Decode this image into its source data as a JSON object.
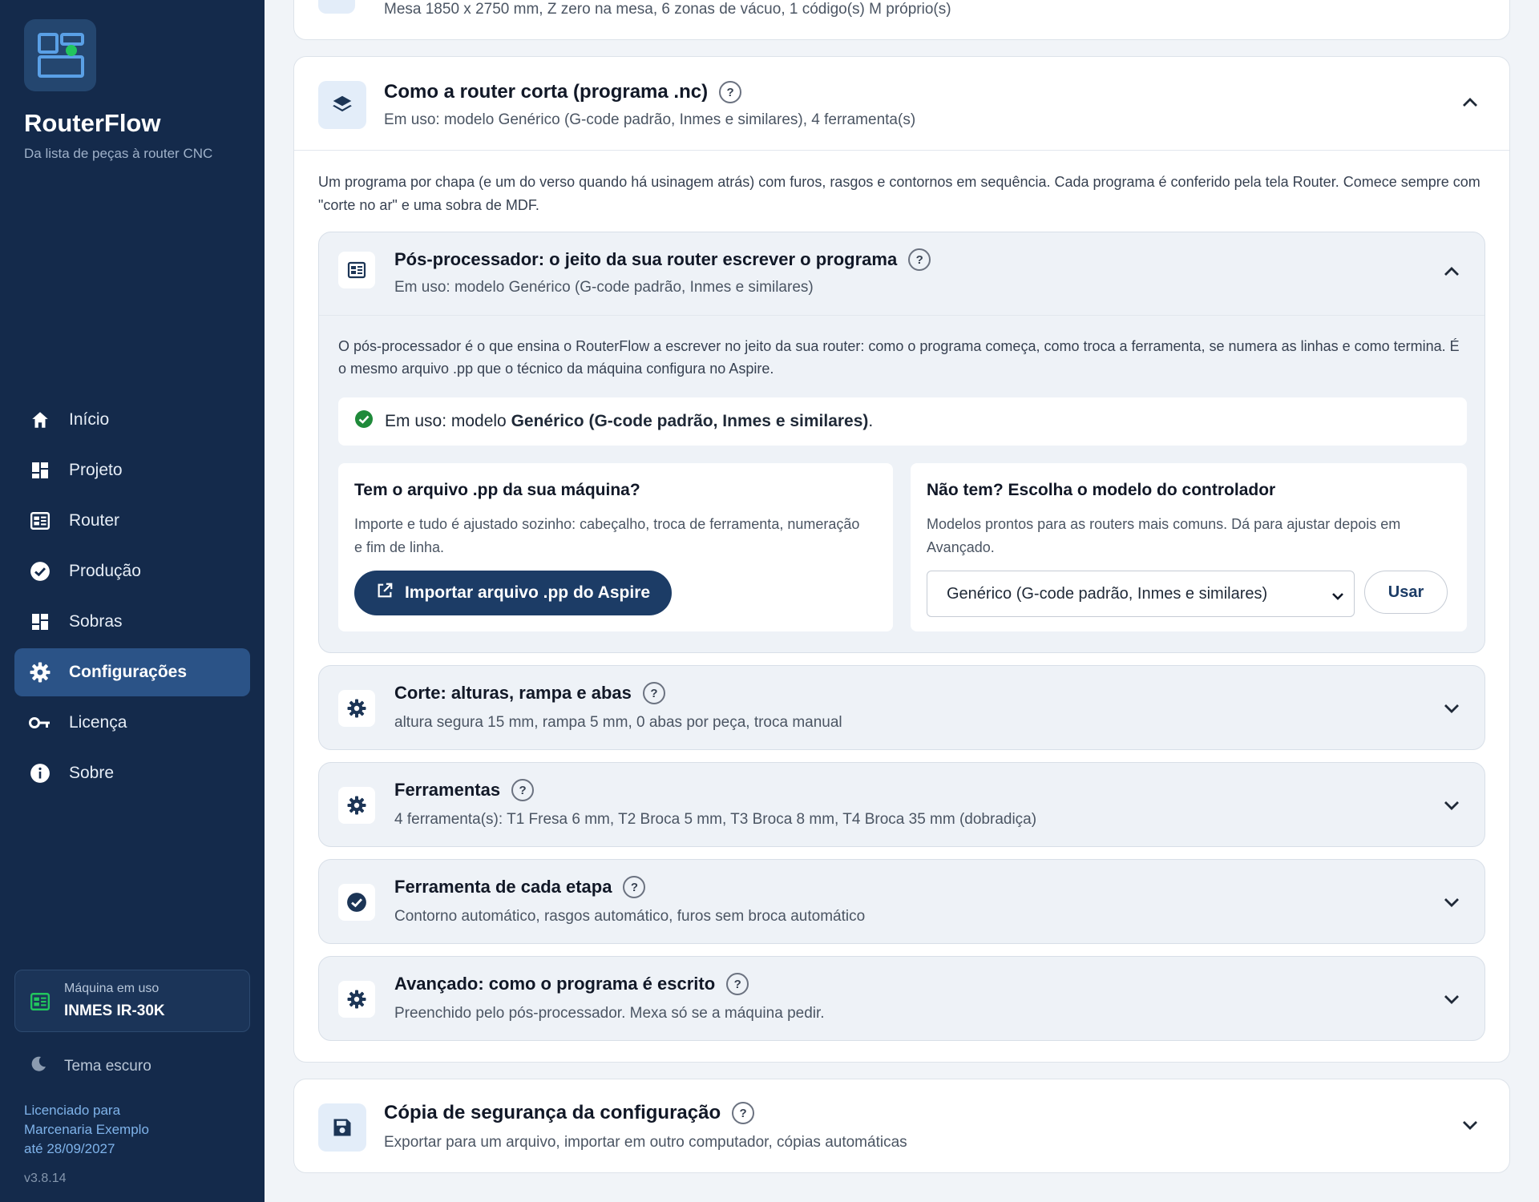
{
  "app": {
    "name": "RouterFlow",
    "tagline": "Da lista de peças à router CNC",
    "colors": {
      "sidebar_bg": "#142a4b",
      "accent": "#1c3c66",
      "success": "#1f8a3a",
      "logo_dot": "#22c55e"
    }
  },
  "sidebar": {
    "items": [
      {
        "label": "Início",
        "icon": "home-icon"
      },
      {
        "label": "Projeto",
        "icon": "dashboard-icon"
      },
      {
        "label": "Router",
        "icon": "router-icon"
      },
      {
        "label": "Produção",
        "icon": "check-circle-icon"
      },
      {
        "label": "Sobras",
        "icon": "dashboard-icon"
      },
      {
        "label": "Configurações",
        "icon": "gear-icon",
        "active": true
      },
      {
        "label": "Licença",
        "icon": "key-icon"
      },
      {
        "label": "Sobre",
        "icon": "info-icon"
      }
    ],
    "machine": {
      "caption": "Máquina em uso",
      "name": "INMES IR-30K"
    },
    "theme_label": "Tema escuro",
    "license": {
      "line1": "Licenciado para",
      "line2": "Marcenaria Exemplo",
      "line3": "até 28/09/2027"
    },
    "version": "v3.8.14"
  },
  "main": {
    "top_card": {
      "subtitle": "Mesa 1850 x 2750 mm, Z zero na mesa, 6 zonas de vácuo, 1 código(s) M próprio(s)"
    },
    "cut_section": {
      "title": "Como a router corta (programa .nc)",
      "subtitle": "Em uso: modelo Genérico (G-code padrão, Inmes e similares), 4 ferramenta(s)",
      "intro": "Um programa por chapa (e um do verso quando há usinagem atrás) com furos, rasgos e contornos em sequência. Cada programa é conferido pela tela Router. Comece sempre com \"corte no ar\" e uma sobra de MDF.",
      "post": {
        "title": "Pós-processador: o jeito da sua router escrever o programa",
        "subtitle": "Em uso: modelo Genérico (G-code padrão, Inmes e similares)",
        "description": "O pós-processador é o que ensina o RouterFlow a escrever no jeito da sua router: como o programa começa, como troca a ferramenta, se numera as linhas e como termina. É o mesmo arquivo .pp que o técnico da máquina configura no Aspire.",
        "in_use_prefix": "Em uso: modelo ",
        "in_use_model": "Genérico (G-code padrão, Inmes e similares)",
        "in_use_suffix": ".",
        "import_box": {
          "title": "Tem o arquivo .pp da sua máquina?",
          "text": "Importe e tudo é ajustado sozinho: cabeçalho, troca de ferramenta, numeração e fim de linha.",
          "button": "Importar arquivo .pp do Aspire"
        },
        "model_box": {
          "title": "Não tem? Escolha o modelo do controlador",
          "text": "Modelos prontos para as routers mais comuns. Dá para ajustar depois em Avançado.",
          "selected": "Genérico (G-code padrão, Inmes e similares)",
          "button": "Usar"
        }
      },
      "subsections": [
        {
          "title": "Corte: alturas, rampa e abas",
          "subtitle": "altura segura 15 mm, rampa 5 mm, 0 abas por peça, troca manual"
        },
        {
          "title": "Ferramentas",
          "subtitle": "4 ferramenta(s): T1 Fresa 6 mm, T2 Broca 5 mm, T3 Broca 8 mm, T4 Broca 35 mm (dobradiça)"
        },
        {
          "title": "Ferramenta de cada etapa",
          "subtitle": "Contorno automático, rasgos automático, furos sem broca automático"
        },
        {
          "title": "Avançado: como o programa é escrito",
          "subtitle": "Preenchido pelo pós-processador. Mexa só se a máquina pedir."
        }
      ]
    },
    "backup_section": {
      "title": "Cópia de segurança da configuração",
      "subtitle": "Exportar para um arquivo, importar em outro computador, cópias automáticas"
    },
    "help_mark": "?"
  }
}
